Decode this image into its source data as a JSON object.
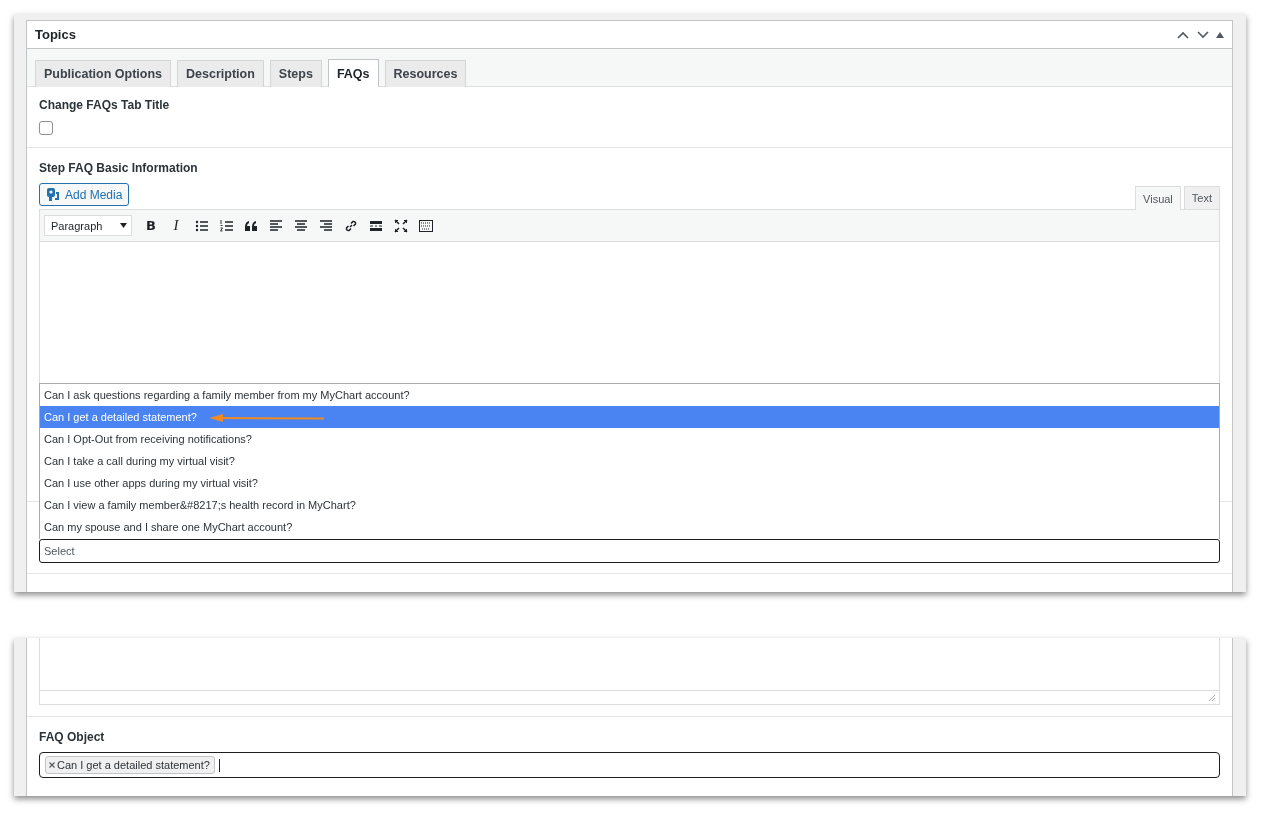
{
  "panel": {
    "title": "Topics"
  },
  "tabs": [
    {
      "label": "Publication Options",
      "selected": false
    },
    {
      "label": "Description",
      "selected": false
    },
    {
      "label": "Steps",
      "selected": false
    },
    {
      "label": "FAQs",
      "selected": true
    },
    {
      "label": "Resources",
      "selected": false
    }
  ],
  "change_title": {
    "label": "Change FAQs Tab Title",
    "checked": false
  },
  "basic_info": {
    "label": "Step FAQ Basic Information",
    "add_media": "Add Media",
    "editor_tabs": [
      {
        "label": "Visual",
        "selected": true
      },
      {
        "label": "Text",
        "selected": false
      }
    ],
    "format_select": "Paragraph",
    "toolbar": [
      {
        "kind": "bold",
        "label": "B"
      },
      {
        "kind": "italic",
        "label": "I"
      },
      {
        "kind": "bullets"
      },
      {
        "kind": "numbers"
      },
      {
        "kind": "quote"
      },
      {
        "kind": "align-left"
      },
      {
        "kind": "align-center"
      },
      {
        "kind": "align-right"
      },
      {
        "kind": "link"
      },
      {
        "kind": "more"
      },
      {
        "kind": "fullscreen"
      },
      {
        "kind": "keyboard"
      }
    ],
    "options": [
      {
        "label": "Can I ask questions regarding a family member from my MyChart account?",
        "selected": false
      },
      {
        "label": "Can I get a detailed statement?",
        "selected": true
      },
      {
        "label": "Can I Opt-Out from receiving notifications?",
        "selected": false
      },
      {
        "label": "Can I take a call during my virtual visit?",
        "selected": false
      },
      {
        "label": "Can I use other apps during my virtual visit?",
        "selected": false
      },
      {
        "label": "Can I view a family member&#8217;s health record in MyChart?",
        "selected": false
      },
      {
        "label": "Can my spouse and I share one MyChart account?",
        "selected": false
      }
    ],
    "select_placeholder": "Select"
  },
  "faq_object": {
    "label": "FAQ Object",
    "tags": [
      "Can I get a detailed statement?"
    ]
  }
}
